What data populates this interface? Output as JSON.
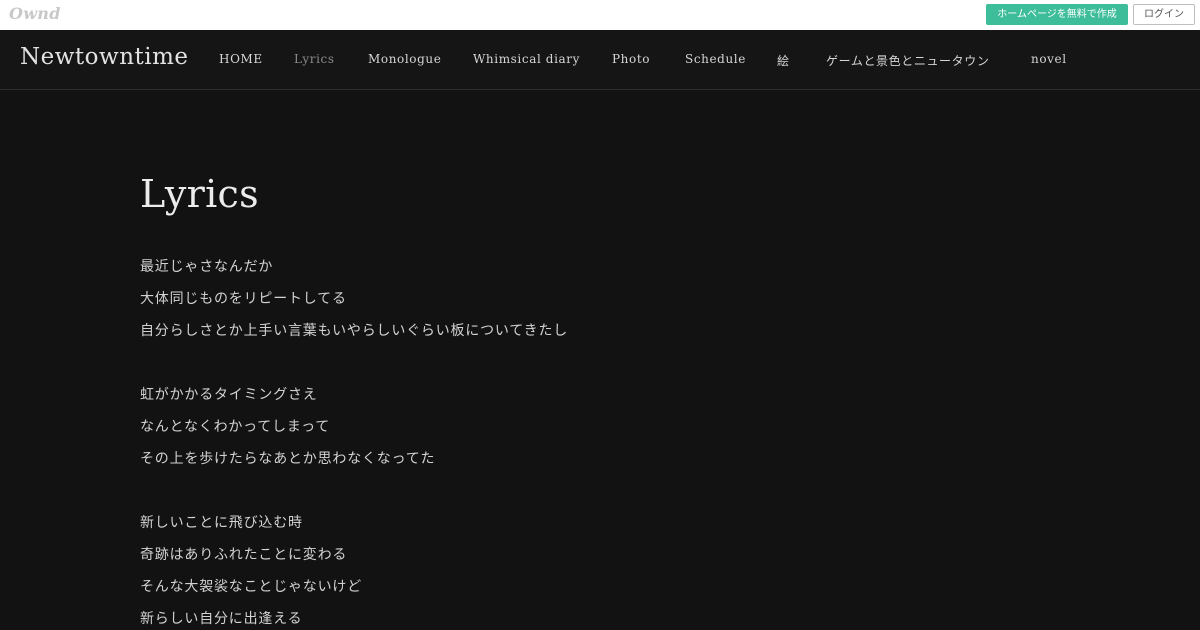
{
  "ownd_bar": {
    "logo": "Ownd",
    "create_button": "ホームページを無料で作成",
    "login_button": "ログイン"
  },
  "site": {
    "title": "Newtowntime"
  },
  "nav": {
    "items": [
      {
        "label": "HOME"
      },
      {
        "label": "Lyrics",
        "active": true
      },
      {
        "label": "Monologue"
      },
      {
        "label": "Whimsical diary"
      },
      {
        "label": "Photo"
      },
      {
        "label": "Schedule"
      },
      {
        "label": "絵"
      },
      {
        "label": "ゲームと景色とニュータウン"
      },
      {
        "label": "novel"
      }
    ]
  },
  "page": {
    "heading": "Lyrics",
    "lines": [
      "最近じゃさなんだか",
      "大体同じものをリピートしてる",
      "自分らしさとか上手い言葉もいやらしいぐらい板についてきたし",
      "虹がかかるタイミングさえ",
      "なんとなくわかってしまって",
      "その上を歩けたらなあとか思わなくなってた",
      "新しいことに飛び込む時",
      "奇跡はありふれたことに変わる",
      "そんな大袈裟なことじゃないけど",
      "新らしい自分に出逢える"
    ]
  },
  "colors": {
    "background": "#121212",
    "accent_green": "#3dbd9a"
  }
}
